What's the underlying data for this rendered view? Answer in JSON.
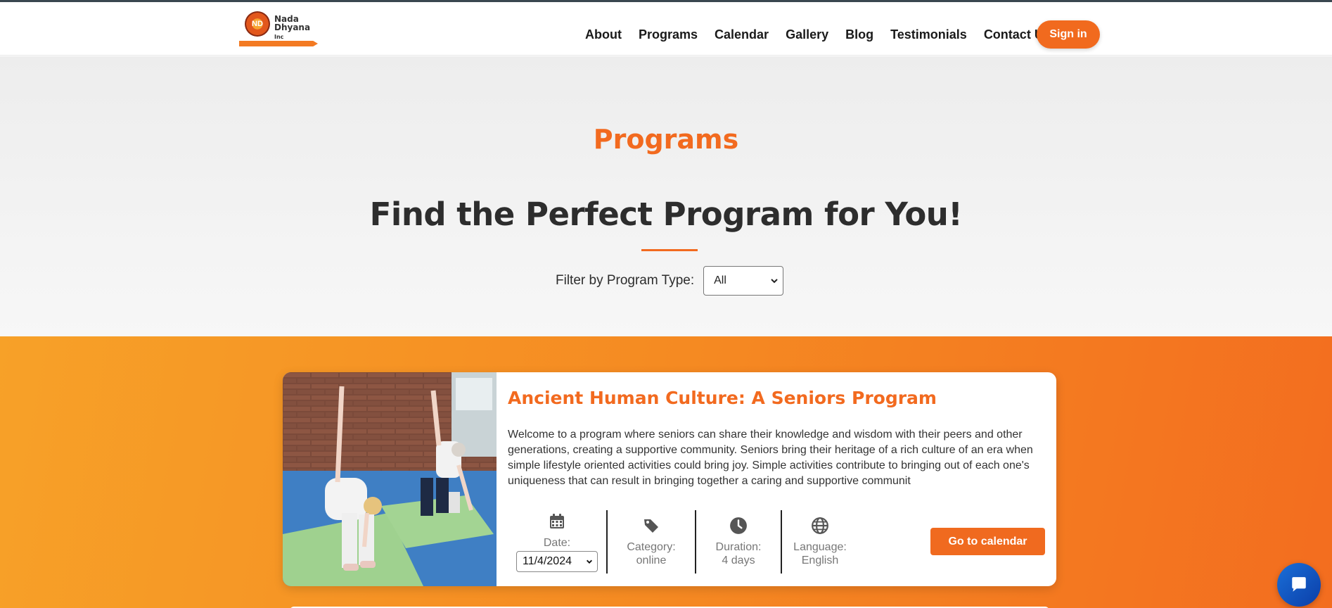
{
  "brand": {
    "name_line1": "Nada",
    "name_line2": "Dhyana",
    "name_suffix": "Inc",
    "logo_mark": "ND"
  },
  "nav": {
    "items": [
      "About",
      "Programs",
      "Calendar",
      "Gallery",
      "Blog",
      "Testimonials",
      "Contact Us"
    ],
    "signin_label": "Sign in"
  },
  "hero": {
    "eyebrow": "Programs",
    "headline": "Find the Perfect Program for You!",
    "filter_label": "Filter by Program Type:",
    "filter_selected": "All"
  },
  "program": {
    "title": "Ancient Human Culture: A Seniors Program",
    "description": "Welcome to a program where seniors can share their knowledge and wisdom with their peers and other generations, creating a supportive community. Seniors bring their heritage of a rich culture of an era when simple lifestyle oriented activities could bring joy. Simple activities contribute to bringing out of each one's uniqueness that can result in bringing together a caring and supportive communit",
    "date_label": "Date:",
    "date_selected": "11/4/2024",
    "category_label": "Category:",
    "category_value": "online",
    "duration_label": "Duration:",
    "duration_value": "4 days",
    "language_label": "Language:",
    "language_value": "English",
    "cta_label": "Go to calendar"
  },
  "colors": {
    "accent": "#f26a1f",
    "band_start": "#f7a128",
    "band_end": "#f36d1f",
    "chat": "#1a6fd8"
  },
  "icons": {
    "calendar": "calendar-icon",
    "category": "tag-icon",
    "duration": "clock-icon",
    "language": "globe-icon",
    "chat": "chat-bubble-icon",
    "select": "chevron-down-icon"
  }
}
